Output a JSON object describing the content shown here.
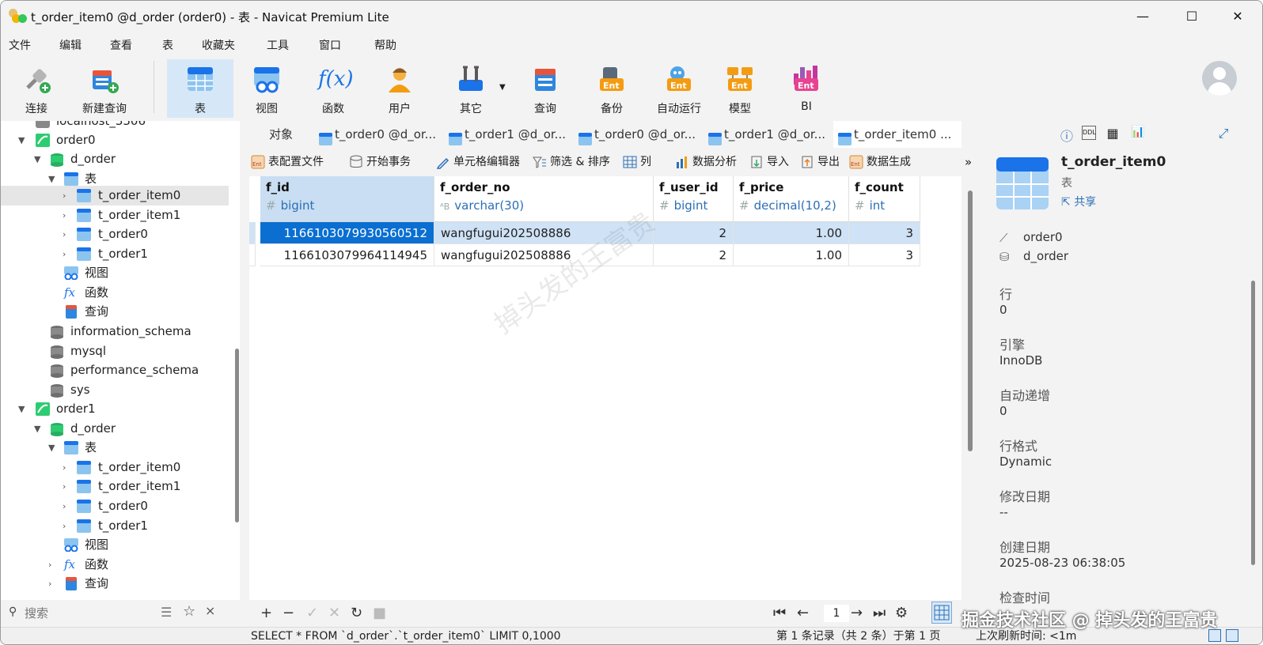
{
  "window": {
    "title": "t_order_item0 @d_order (order0) - 表 - Navicat Premium Lite",
    "minimize": "—",
    "maximize": "☐",
    "close": "✕"
  },
  "menu": [
    "文件",
    "编辑",
    "查看",
    "表",
    "收藏夹",
    "工具",
    "窗口",
    "帮助"
  ],
  "toolbar": {
    "connect": "连接",
    "new_query": "新建查询",
    "table": "表",
    "view": "视图",
    "function": "函数",
    "user": "用户",
    "other": "其它",
    "query": "查询",
    "backup": "备份",
    "automation": "自动运行",
    "model": "模型",
    "bi": "BI"
  },
  "tree": {
    "cut_top": "localhost_3306",
    "conn1": "order0",
    "db1": "d_order",
    "tables1": "表",
    "t1": [
      "t_order_item0",
      "t_order_item1",
      "t_order0",
      "t_order1"
    ],
    "views": "视图",
    "functions": "函数",
    "queries": "查询",
    "dbs": [
      "information_schema",
      "mysql",
      "performance_schema",
      "sys"
    ],
    "conn2": "order1",
    "db2": "d_order",
    "tables2": "表",
    "t2": [
      "t_order_item0",
      "t_order_item1",
      "t_order0",
      "t_order1"
    ],
    "views2": "视图",
    "functions2": "函数",
    "queries2": "查询"
  },
  "search": {
    "placeholder": "搜索"
  },
  "tabs": {
    "objects": "对象",
    "t1": "t_order0 @d_or...",
    "t2": "t_order1 @d_or...",
    "t3": "t_order0 @d_or...",
    "t4": "t_order1 @d_or...",
    "t5": "t_order_item0 ..."
  },
  "subtoolbar": {
    "profile": "表配置文件",
    "begin_tx": "开始事务",
    "cell_editor": "单元格编辑器",
    "filter_sort": "筛选 & 排序",
    "columns": "列",
    "analysis": "数据分析",
    "import": "导入",
    "export": "导出",
    "generate": "数据生成",
    "more": "»"
  },
  "table": {
    "columns": [
      {
        "name": "f_id",
        "type": "bigint"
      },
      {
        "name": "f_order_no",
        "type": "varchar(30)"
      },
      {
        "name": "f_user_id",
        "type": "bigint"
      },
      {
        "name": "f_price",
        "type": "decimal(10,2)"
      },
      {
        "name": "f_count",
        "type": "int"
      }
    ],
    "rows": [
      [
        "1166103079930560512",
        "wangfugui202508886",
        "2",
        "1.00",
        "3"
      ],
      [
        "1166103079964114945",
        "wangfugui202508886",
        "2",
        "1.00",
        "3"
      ]
    ]
  },
  "watermark": "掉头发的王富贵",
  "pager": {
    "page": "1"
  },
  "info": {
    "name": "t_order_item0",
    "kind": "表",
    "share": "共享",
    "connection": "order0",
    "database": "d_order",
    "rows_label": "行",
    "rows_value": "0",
    "engine_label": "引擎",
    "engine_value": "InnoDB",
    "autoinc_label": "自动递增",
    "autoinc_value": "0",
    "rowformat_label": "行格式",
    "rowformat_value": "Dynamic",
    "modified_label": "修改日期",
    "modified_value": "--",
    "created_label": "创建日期",
    "created_value": "2025-08-23 06:38:05",
    "checked_label": "检查时间"
  },
  "status": {
    "sql": "SELECT * FROM `d_order`.`t_order_item0` LIMIT 0,1000",
    "record": "第 1 条记录（共 2 条）于第 1 页",
    "refresh": "上次刷新时间: <1m"
  },
  "corner_watermark": "掘金技术社区 @ 掉头发的王富贵"
}
